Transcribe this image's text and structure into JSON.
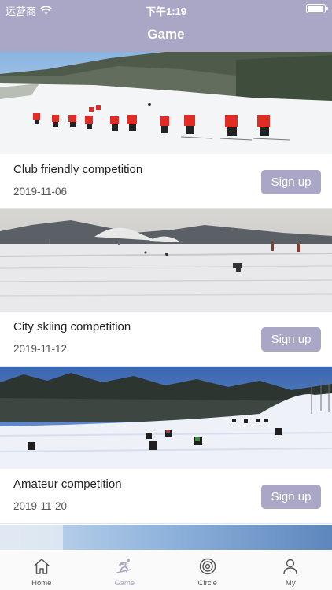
{
  "status_bar": {
    "carrier": "运营商",
    "time": "下午1:19"
  },
  "nav": {
    "title": "Game"
  },
  "events": [
    {
      "title": "Club friendly competition",
      "date": "2019-11-06",
      "action": "Sign up"
    },
    {
      "title": "City skiing competition",
      "date": "2019-11-12",
      "action": "Sign up"
    },
    {
      "title": "Amateur competition",
      "date": "2019-11-20",
      "action": "Sign up"
    }
  ],
  "tabs": [
    {
      "label": "Home",
      "icon": "home-icon",
      "active": false
    },
    {
      "label": "Game",
      "icon": "skier-icon",
      "active": true
    },
    {
      "label": "Circle",
      "icon": "circle-target-icon",
      "active": false
    },
    {
      "label": "My",
      "icon": "person-icon",
      "active": false
    }
  ],
  "colors": {
    "accent": "#aaa6c6",
    "tab_inactive": "#555555"
  }
}
